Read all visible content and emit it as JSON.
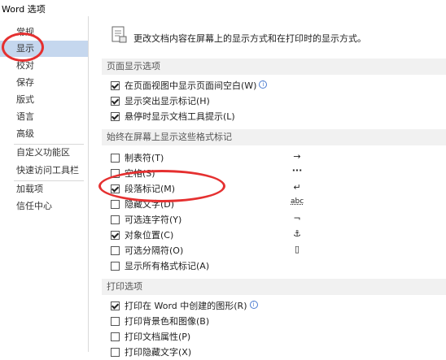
{
  "window": {
    "title": "Word 选项"
  },
  "sidebar": {
    "items": [
      {
        "label": "常规"
      },
      {
        "label": "显示"
      },
      {
        "label": "校对"
      },
      {
        "label": "保存"
      },
      {
        "label": "版式"
      },
      {
        "label": "语言"
      },
      {
        "label": "高级"
      },
      {
        "label": "自定义功能区"
      },
      {
        "label": "快速访问工具栏"
      },
      {
        "label": "加载项"
      },
      {
        "label": "信任中心"
      }
    ],
    "selected": "显示"
  },
  "main": {
    "description": "更改文档内容在屏幕上的显示方式和在打印时的显示方式。",
    "sections": {
      "page_display": {
        "title": "页面显示选项",
        "options": [
          {
            "label": "在页面视图中显示页面间空白(W)",
            "checked": true
          },
          {
            "label": "显示突出显示标记(H)",
            "checked": true
          },
          {
            "label": "悬停时显示文档工具提示(L)",
            "checked": true
          }
        ]
      },
      "format_marks": {
        "title": "始终在屏幕上显示这些格式标记",
        "options": [
          {
            "label": "制表符(T)",
            "checked": false,
            "symbol": "→"
          },
          {
            "label": "空格(S)",
            "checked": false,
            "symbol": "···"
          },
          {
            "label": "段落标记(M)",
            "checked": true,
            "symbol": "↵"
          },
          {
            "label": "隐藏文字(D)",
            "checked": false,
            "symbol": "abc"
          },
          {
            "label": "可选连字符(Y)",
            "checked": false,
            "symbol": "¬"
          },
          {
            "label": "对象位置(C)",
            "checked": true,
            "symbol": "⚓"
          },
          {
            "label": "可选分隔符(O)",
            "checked": false,
            "symbol": "▯"
          },
          {
            "label": "显示所有格式标记(A)",
            "checked": false
          }
        ]
      },
      "print": {
        "title": "打印选项",
        "options": [
          {
            "label": "打印在 Word 中创建的图形(R)",
            "checked": true
          },
          {
            "label": "打印背景色和图像(B)",
            "checked": false
          },
          {
            "label": "打印文档属性(P)",
            "checked": false
          },
          {
            "label": "打印隐藏文字(X)",
            "checked": false
          }
        ]
      }
    }
  },
  "annotations": {
    "highlight_color": "#e53030"
  }
}
